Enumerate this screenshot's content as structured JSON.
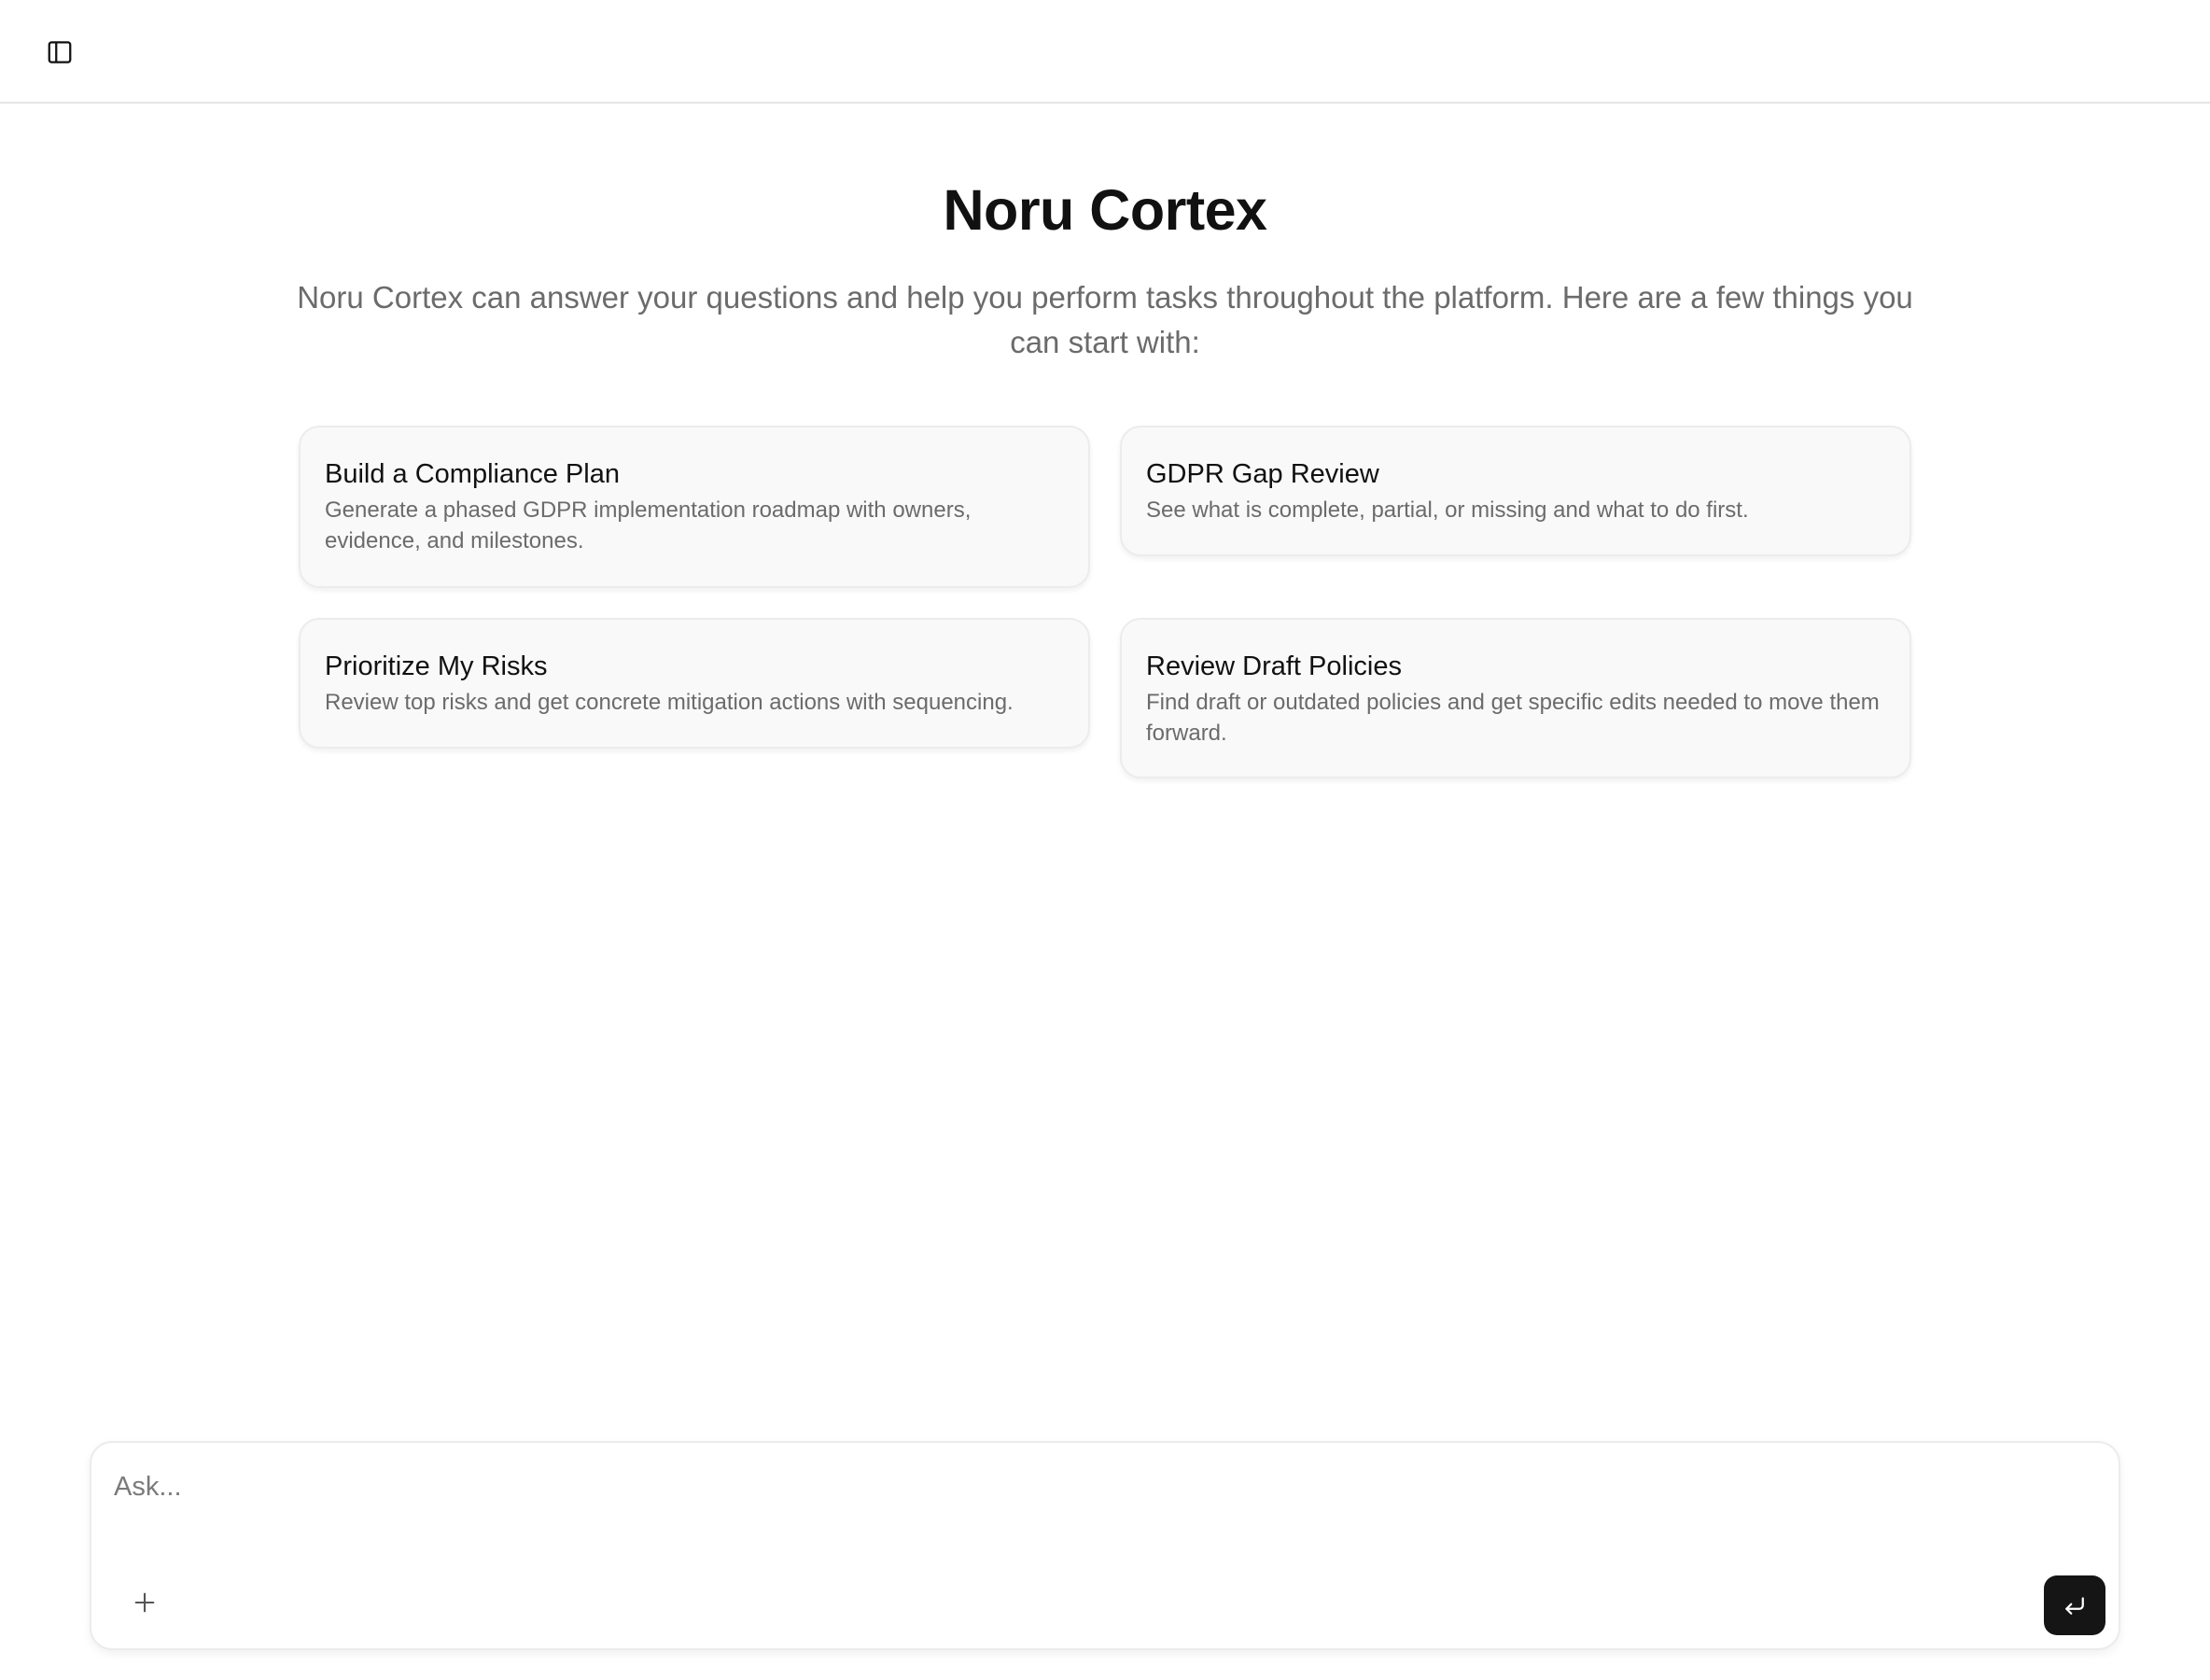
{
  "header": {
    "sidebar_toggle_icon": "sidebar-panel-icon"
  },
  "hero": {
    "title": "Noru Cortex",
    "subtitle": "Noru Cortex can answer your questions and help you perform tasks throughout the platform. Here are a few things you can start with:"
  },
  "suggestions": [
    {
      "title": "Build a Compliance Plan",
      "description": "Generate a phased GDPR implementation roadmap with owners, evidence, and milestones."
    },
    {
      "title": "GDPR Gap Review",
      "description": "See what is complete, partial, or missing and what to do first."
    },
    {
      "title": "Prioritize My Risks",
      "description": "Review top risks and get concrete mitigation actions with sequencing."
    },
    {
      "title": "Review Draft Policies",
      "description": "Find draft or outdated policies and get specific edits needed to move them forward."
    }
  ],
  "composer": {
    "placeholder": "Ask...",
    "value": "",
    "attach_icon": "plus-icon",
    "send_icon": "enter-return-icon"
  },
  "colors": {
    "send_button_bg": "#151515",
    "card_bg": "#f9f9f9",
    "muted_text": "#6b6b6b"
  }
}
